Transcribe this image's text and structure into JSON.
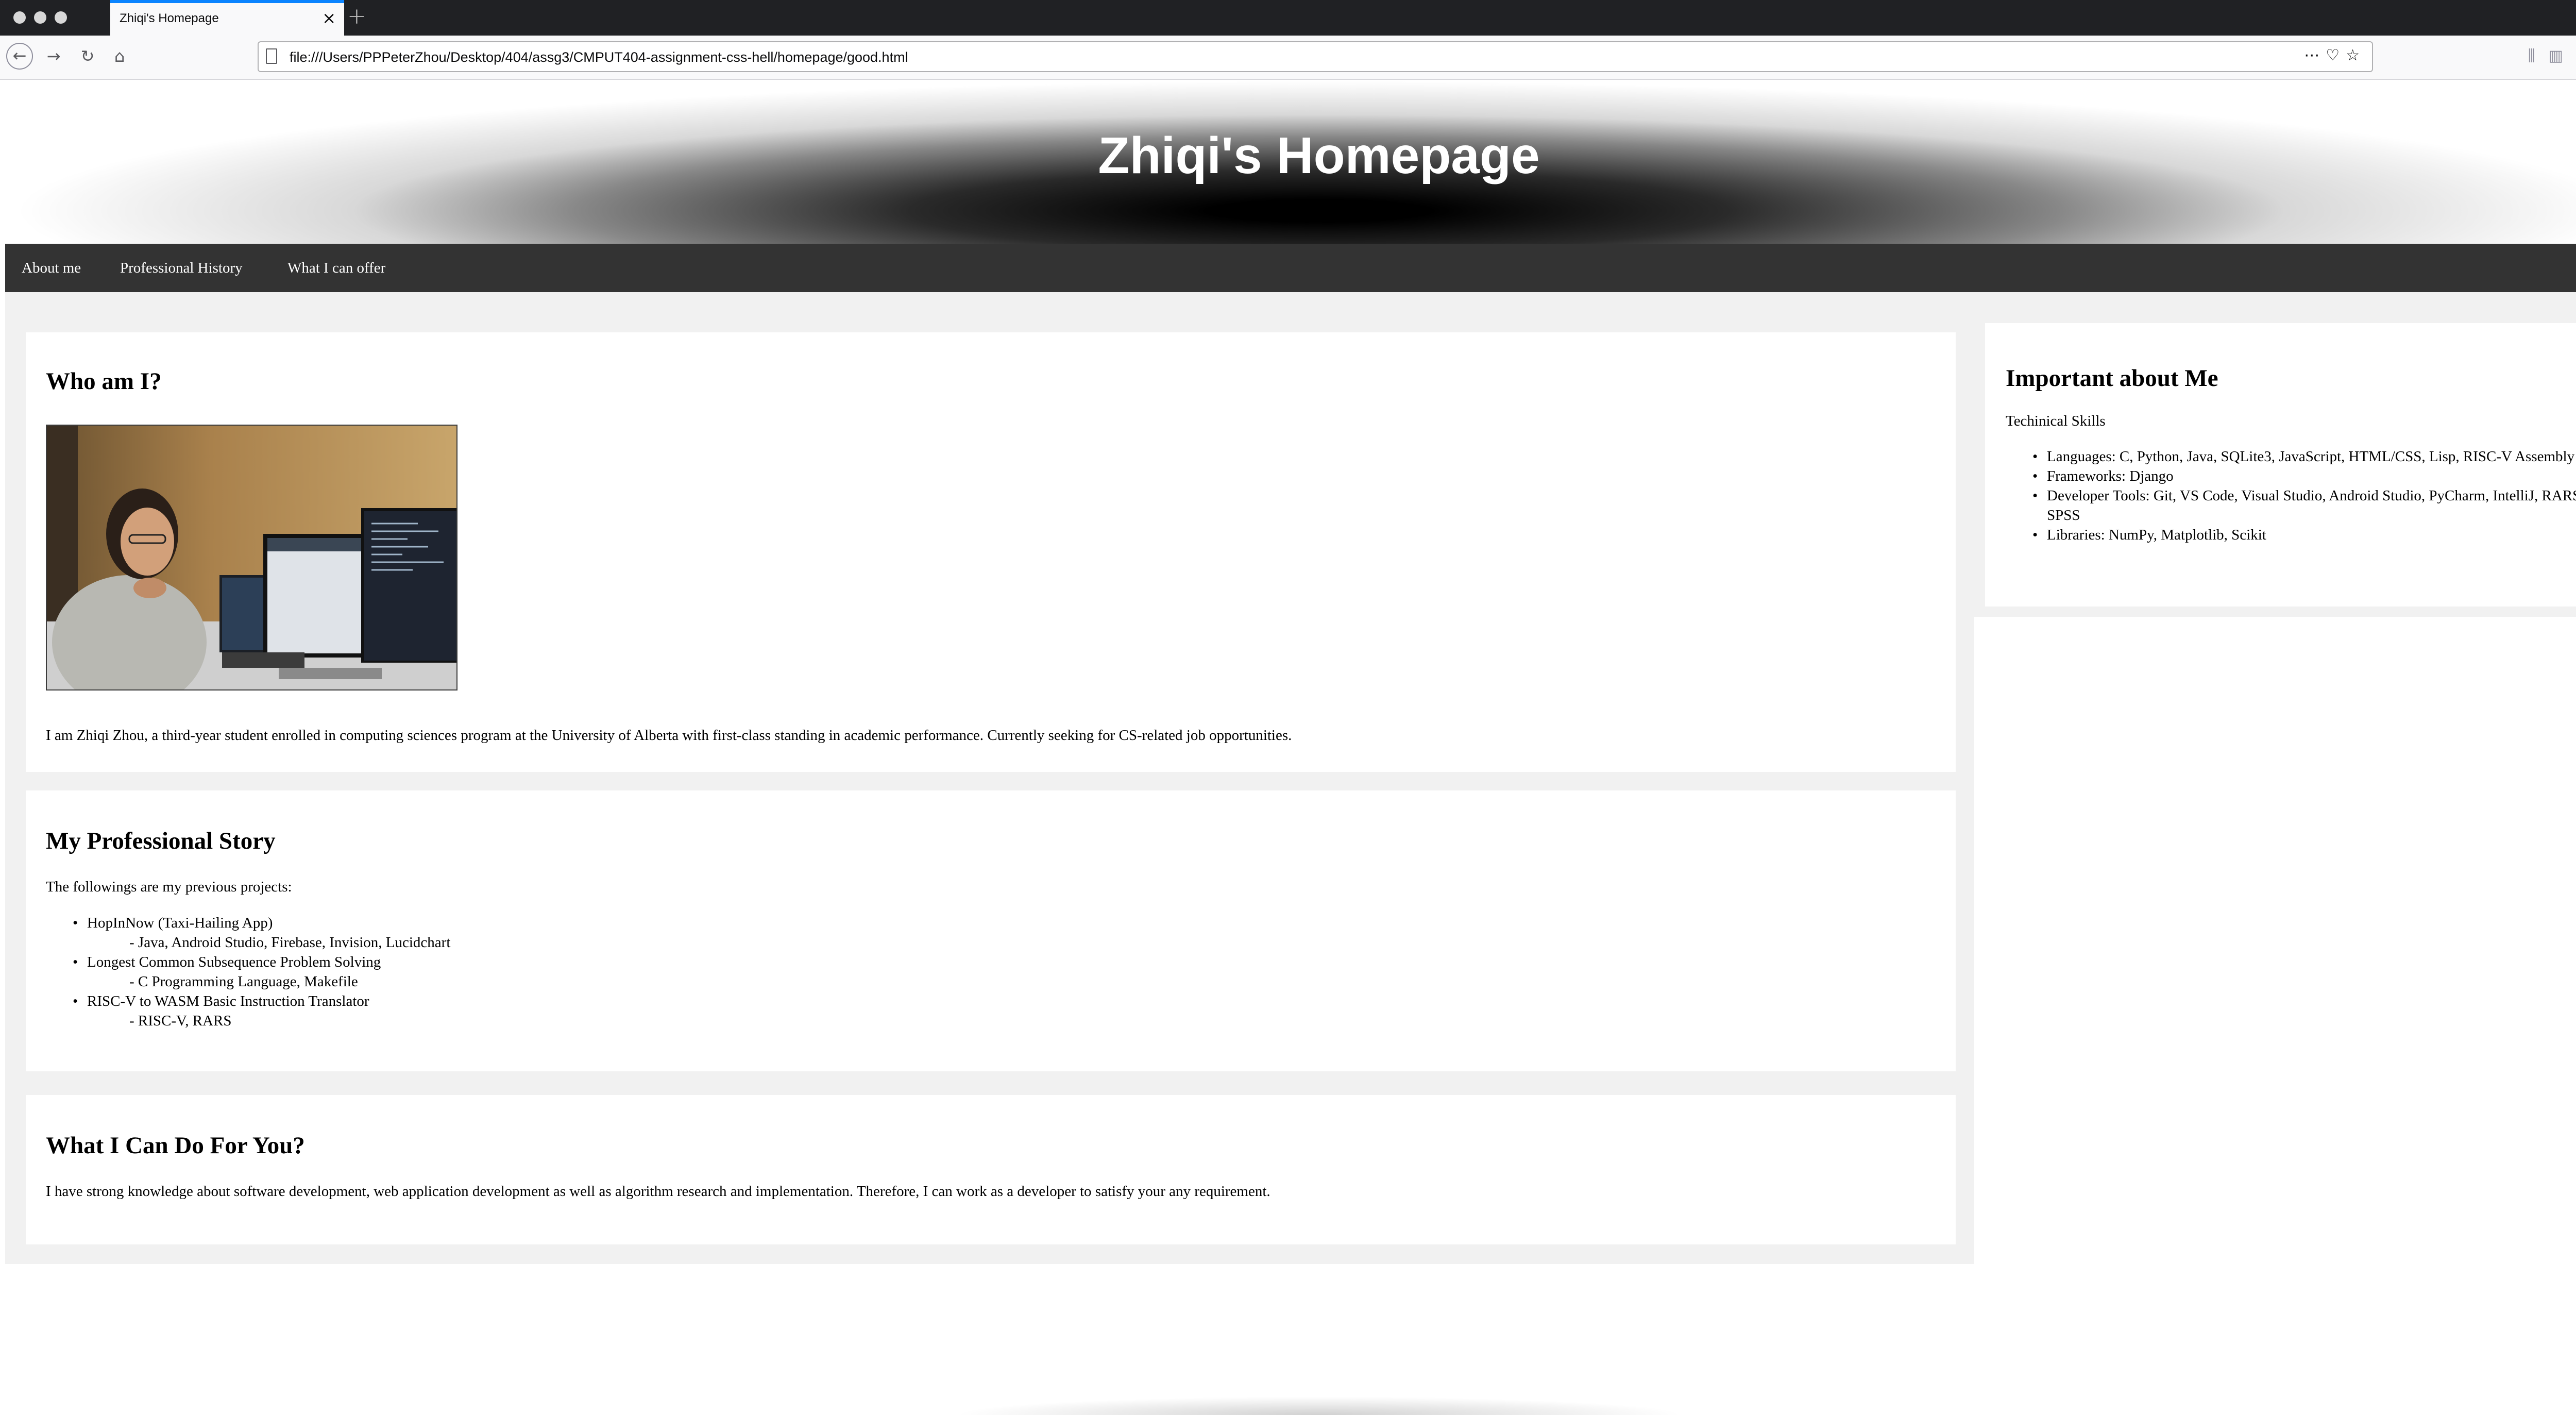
{
  "browser": {
    "tab_title": "Zhiqi's Homepage",
    "tab_close": "×",
    "new_tab": "+",
    "url": "file:///Users/PPPeterZhou/Desktop/404/assg3/CMPUT404-assignment-css-hell/homepage/good.html",
    "icons": [
      "back-arrow-icon",
      "forward-arrow-icon",
      "reload-icon",
      "home-icon",
      "page-icon",
      "more-icon",
      "pocket-icon",
      "star-icon",
      "library-icon",
      "sidebar-icon",
      "account-icon",
      "menu-icon"
    ]
  },
  "header": {
    "title": "Zhiqi's Homepage"
  },
  "nav": {
    "items": [
      "About me",
      "Professional History",
      "What I can offer"
    ]
  },
  "who": {
    "heading": "Who am I?",
    "photo_alt": "photo of Zhiqi at desk with computer monitors",
    "text": "I am Zhiqi Zhou, a third-year student enrolled in computing sciences program at the University of Alberta with first-class standing in academic performance. Currently seeking for CS-related job opportunities."
  },
  "story": {
    "heading": "My Professional Story",
    "intro": "The followings are my previous projects:",
    "projects": [
      {
        "name": "HopInNow (Taxi-Hailing App)",
        "tech": "- Java, Android Studio, Firebase, Invision, Lucidchart"
      },
      {
        "name": "Longest Common Subsequence Problem Solving",
        "tech": "- C Programming Language, Makefile"
      },
      {
        "name": "RISC-V to WASM Basic Instruction Translator",
        "tech": "- RISC-V, RARS"
      }
    ]
  },
  "offer": {
    "heading": "What I Can Do For You?",
    "text": "I have strong knowledge about software development, web application development as well as algorithm research and implementation. Therefore, I can work as a developer to satisfy your any requirement."
  },
  "important": {
    "heading": "Important about Me",
    "subheading": "Techinical Skills",
    "skills": [
      "Languages: C, Python, Java, SQLite3, JavaScript, HTML/CSS, Lisp, RISC-V Assembly",
      "Frameworks: Django",
      "Developer Tools: Git, VS Code, Visual Studio, Android Studio, PyCharm, IntelliJ, RARS, SPSS",
      "Libraries: NumPy, Matplotlib, Scikit"
    ]
  }
}
